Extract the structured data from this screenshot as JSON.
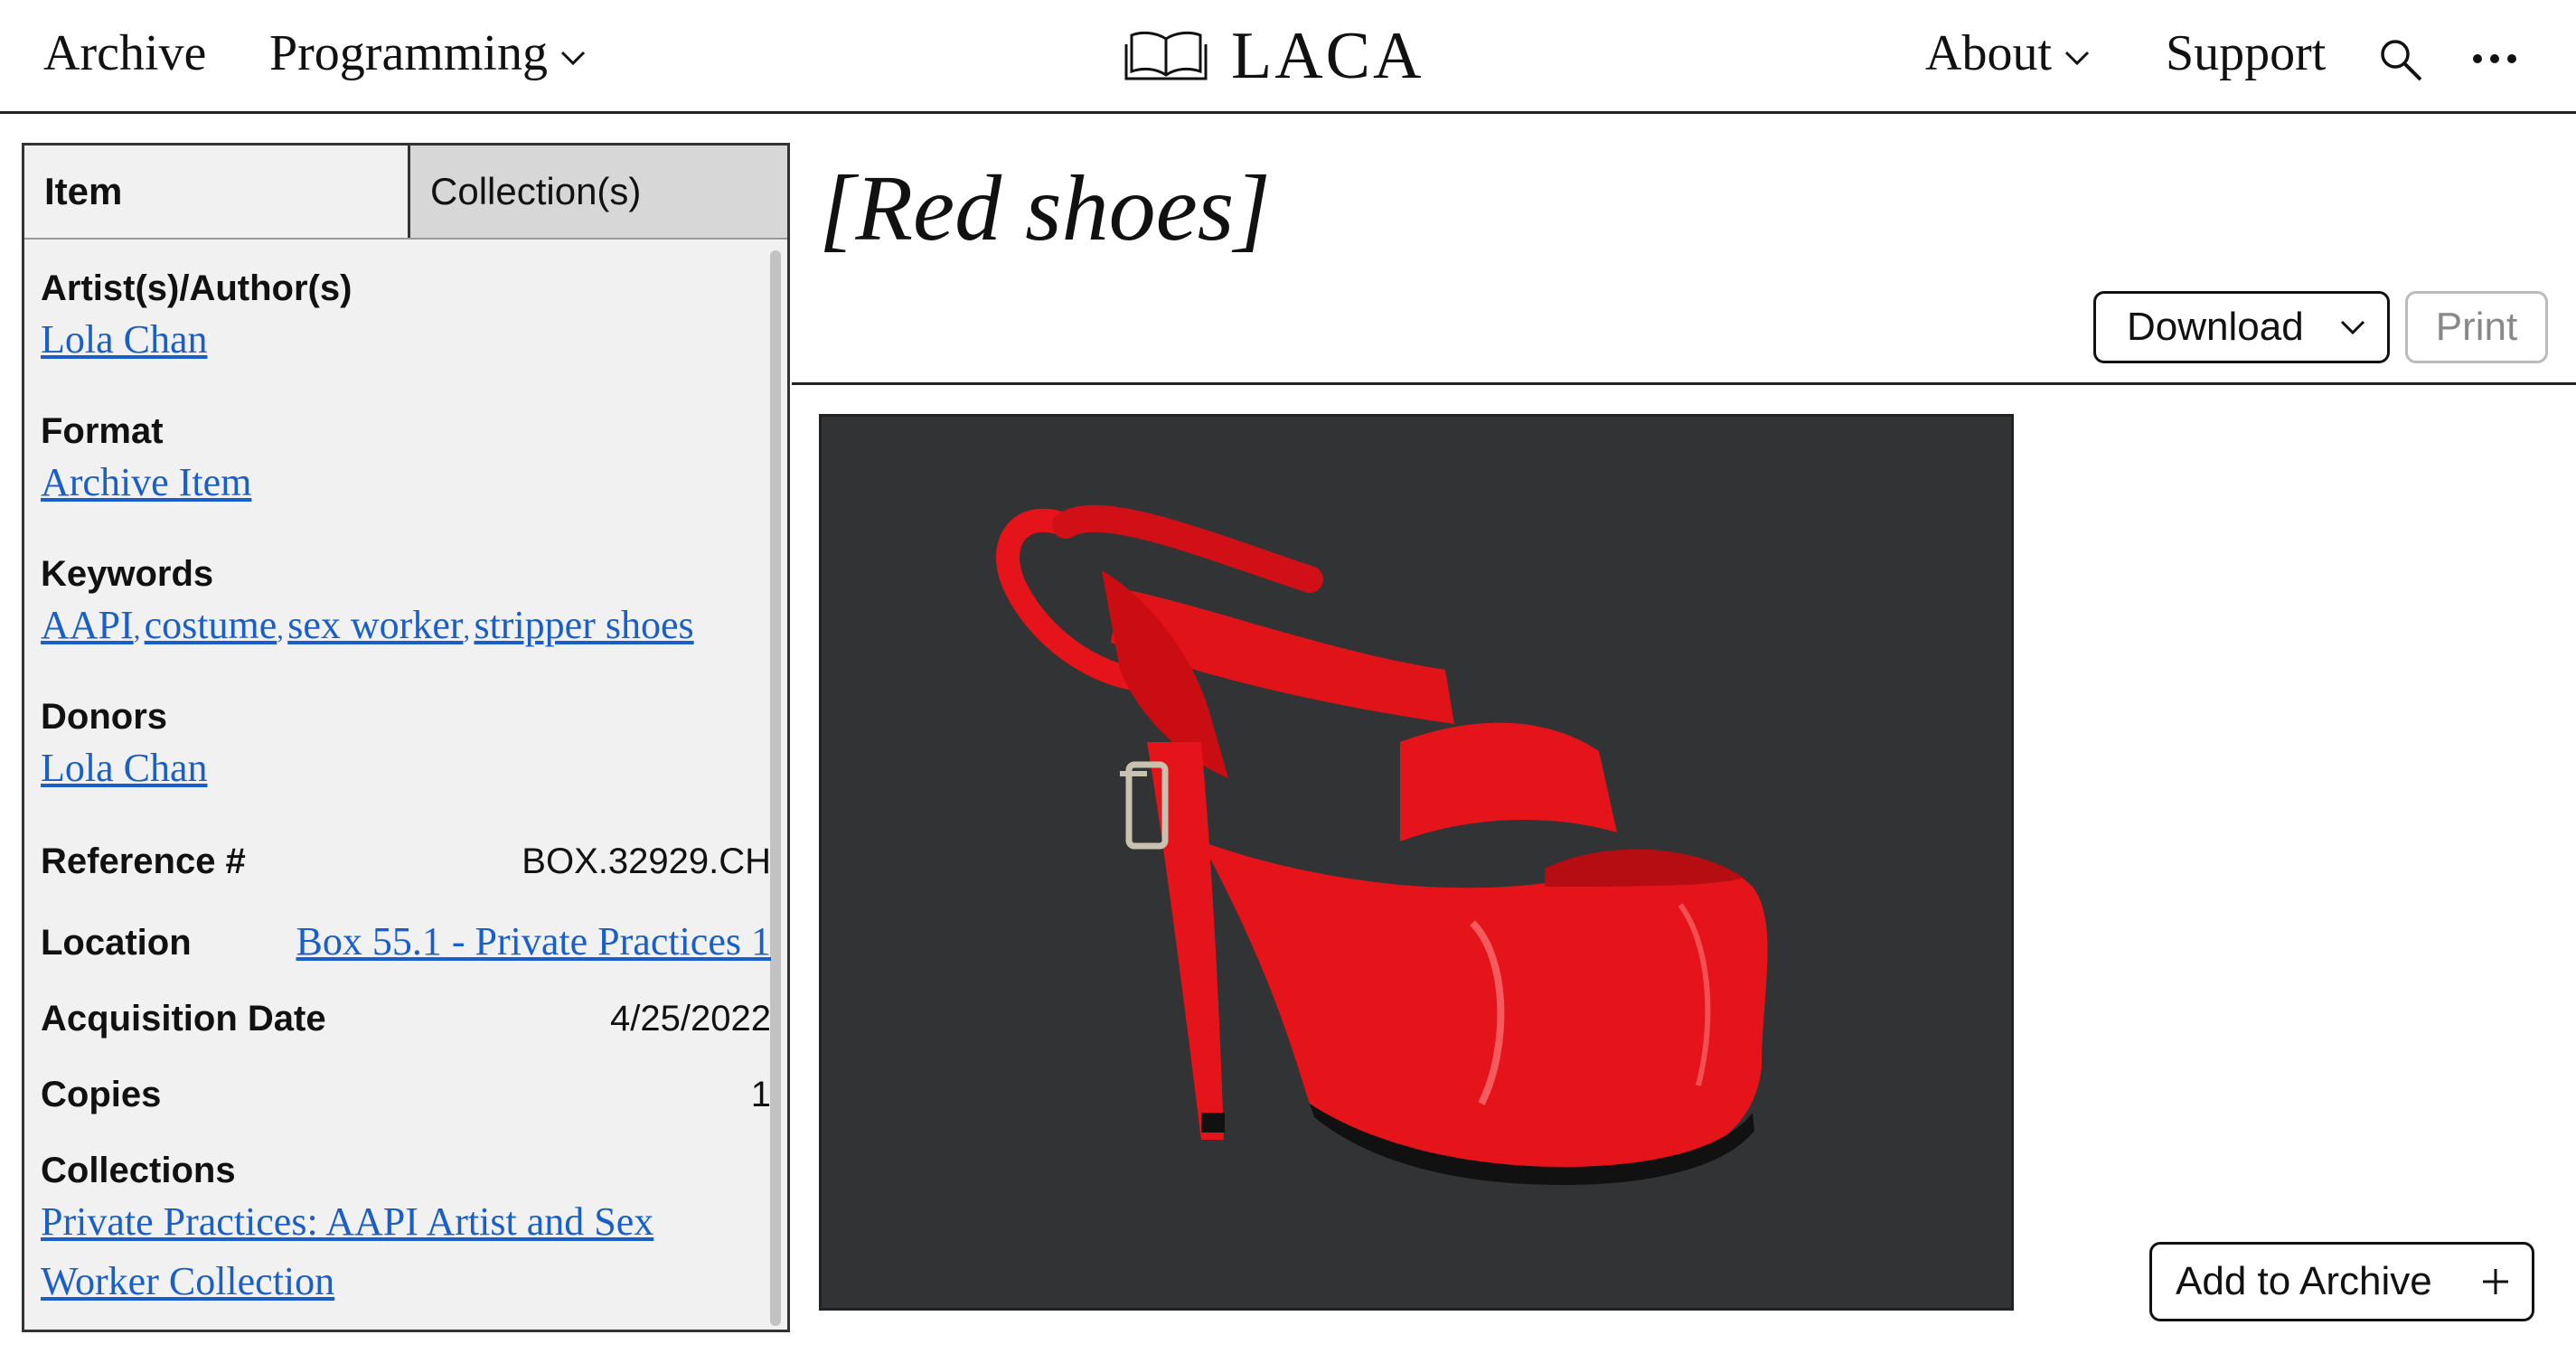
{
  "header": {
    "nav_left": [
      {
        "label": "Archive"
      },
      {
        "label": "Programming"
      }
    ],
    "logo_text": "LACA",
    "nav_right": [
      {
        "label": "About"
      },
      {
        "label": "Support"
      }
    ]
  },
  "sidebar": {
    "tabs": [
      {
        "label": "Item"
      },
      {
        "label": "Collection(s)"
      }
    ],
    "artists": {
      "label": "Artist(s)/Author(s)",
      "links": [
        "Lola Chan"
      ]
    },
    "format": {
      "label": "Format",
      "links": [
        "Archive Item"
      ]
    },
    "keywords": {
      "label": "Keywords",
      "links": [
        "AAPI",
        "costume",
        "sex worker",
        "stripper shoes"
      ],
      "separator": ","
    },
    "donors": {
      "label": "Donors",
      "links": [
        "Lola Chan"
      ]
    },
    "reference": {
      "label": "Reference #",
      "value": "BOX.32929.CH"
    },
    "location": {
      "label": "Location",
      "value": "Box 55.1 - Private Practices 1"
    },
    "acquisition": {
      "label": "Acquisition Date",
      "value": "4/25/2022"
    },
    "copies": {
      "label": "Copies",
      "value": "1"
    },
    "collections": {
      "label": "Collections",
      "links": [
        "Private Practices: AAPI Artist and Sex",
        "Worker Collection"
      ]
    }
  },
  "main": {
    "title": "[Red shoes]",
    "download_label": "Download",
    "print_label": "Print",
    "add_label": "Add to Archive",
    "image_alt": "Red platform high-heel shoe on dark background"
  },
  "colors": {
    "link": "#1a5fc9",
    "shoe_red": "#e4141a",
    "backdrop": "#2f3133"
  }
}
